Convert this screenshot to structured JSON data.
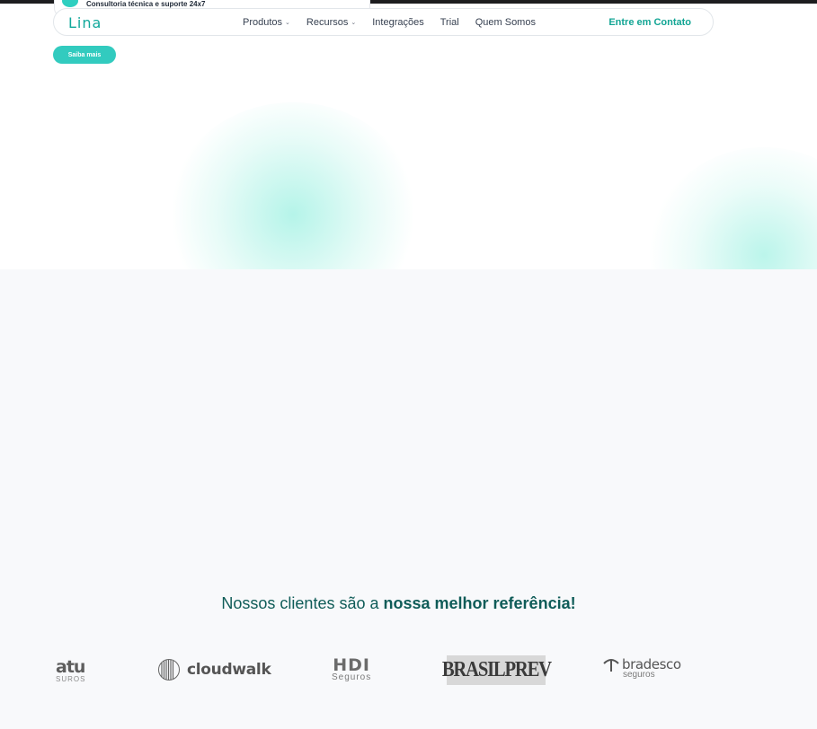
{
  "colors": {
    "accent": "#32cbbf",
    "brand_text": "#12a594",
    "headline": "#0f5c58",
    "section_bg": "#f8f9fb"
  },
  "behind_card": {
    "text": "Consultoria técnica e suporte 24x7"
  },
  "navbar": {
    "logo_text": "Lina",
    "links": [
      {
        "label": "Produtos",
        "has_dropdown": true
      },
      {
        "label": "Recursos",
        "has_dropdown": true
      },
      {
        "label": "Integrações",
        "has_dropdown": false
      },
      {
        "label": "Trial",
        "has_dropdown": false
      },
      {
        "label": "Quem Somos",
        "has_dropdown": false
      }
    ],
    "dropdown_glyph": "⌄",
    "contact_label": "Entre em Contato"
  },
  "hero": {
    "cta_label": "Saiba mais"
  },
  "clients": {
    "heading_normal": "Nossos clientes são a ",
    "heading_bold": "nossa melhor referência!",
    "logos": {
      "itau": {
        "main": "atu",
        "sub": "SUROS"
      },
      "cloudwalk": {
        "main": "cloudwalk"
      },
      "hdi": {
        "main": "HDI",
        "sub": "Seguros"
      },
      "brasilprev": {
        "main": "BRASILPREV"
      },
      "bradesco": {
        "main": "bradesco",
        "sub": "seguros"
      }
    }
  }
}
